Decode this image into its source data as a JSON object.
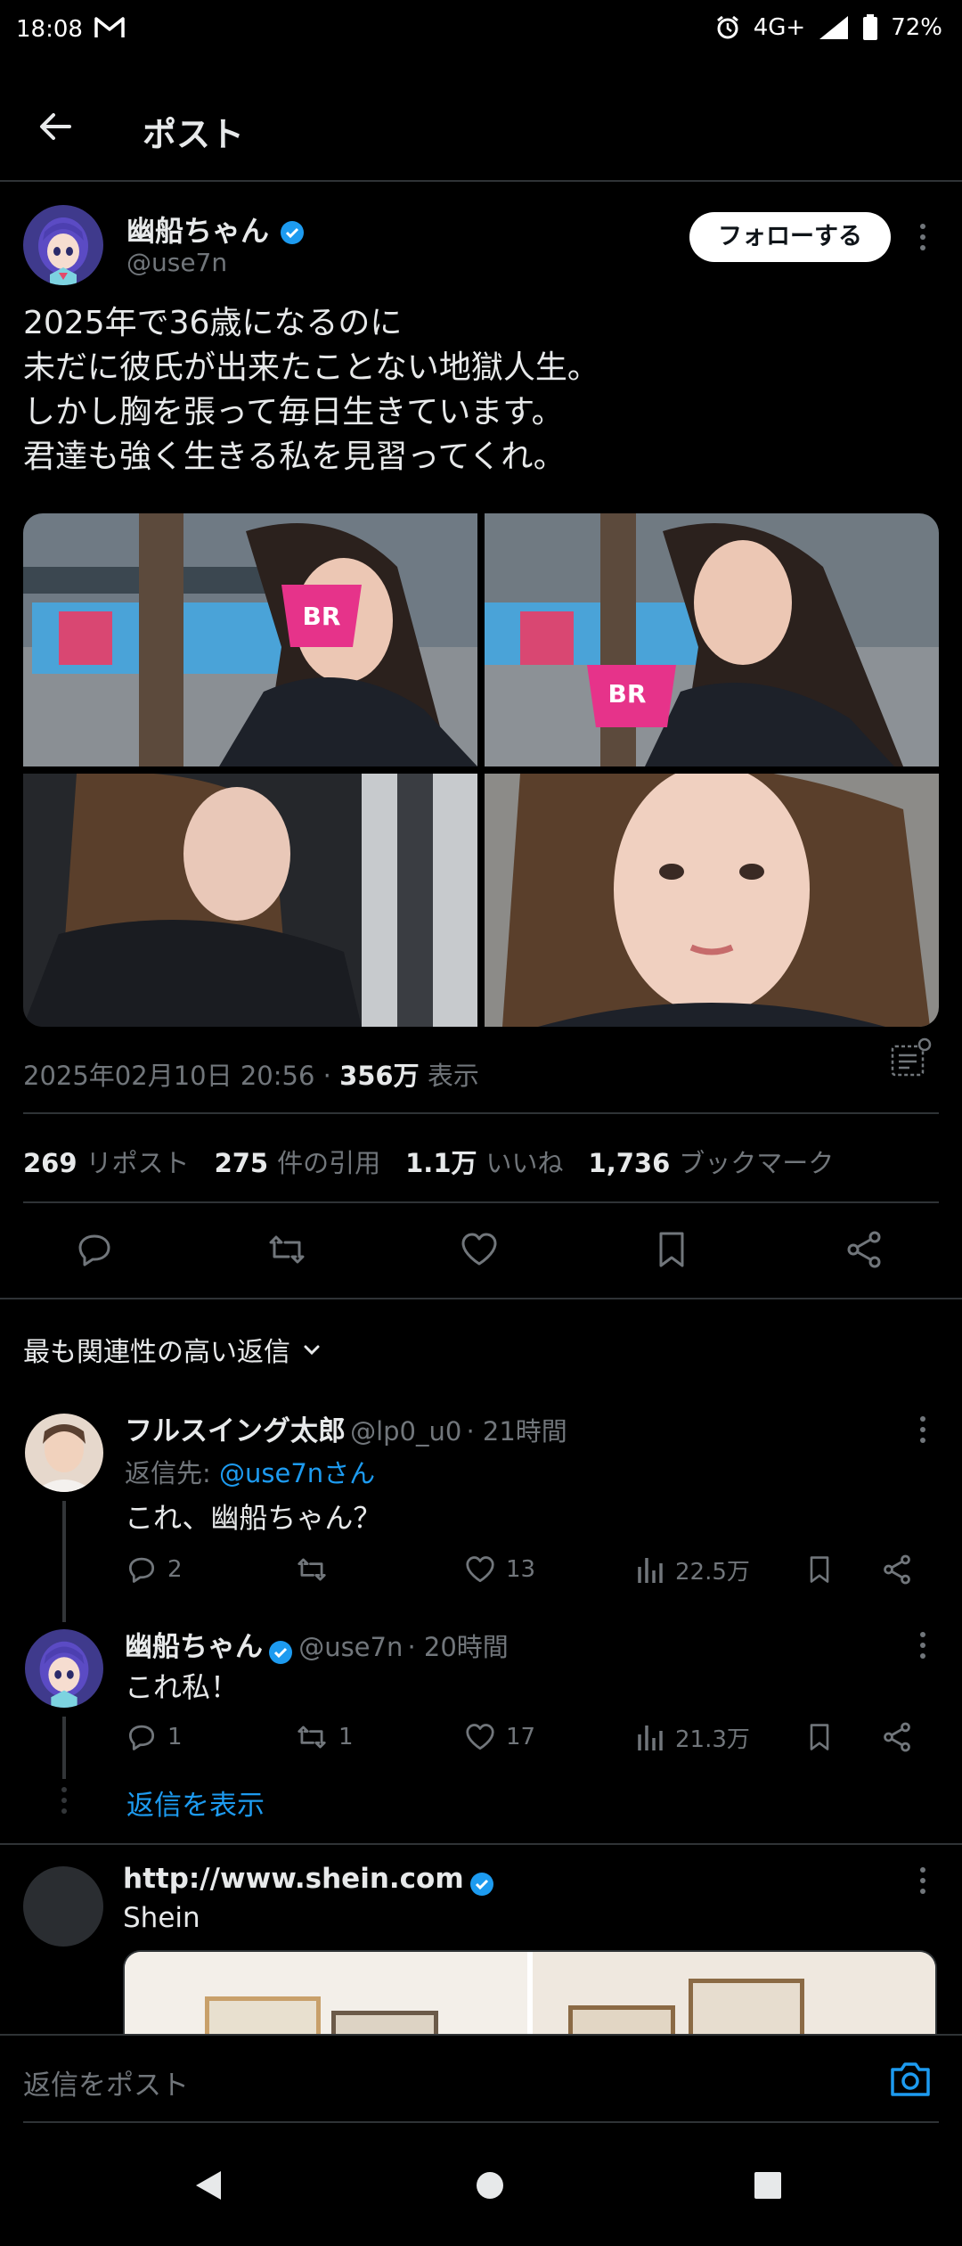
{
  "status_bar": {
    "time": "18:08",
    "network": "4G+",
    "battery": "72%"
  },
  "header": {
    "title": "ポスト"
  },
  "post": {
    "author_name": "幽船ちゃん",
    "author_handle": "@use7n",
    "follow_label": "フォローする",
    "text": "2025年で36歳になるのに\n未だに彼氏が出来たことない地獄人生。\nしかし胸を張って毎日生きています。\n君達も強く生きる私を見習ってくれ。",
    "cup_logo": "BR",
    "date": "2025年02月10日 20:56",
    "separator": "·",
    "views": "356万",
    "views_label": "表示",
    "stats": {
      "reposts": "269",
      "reposts_label": "リポスト",
      "quotes": "275",
      "quotes_label": "件の引用",
      "likes": "1.1万",
      "likes_label": "いいね",
      "bookmarks": "1,736",
      "bookmarks_label": "ブックマーク"
    }
  },
  "sort_label": "最も関連性の高い返信",
  "replies": [
    {
      "name": "フルスイング太郎",
      "handle": "@lp0_u0",
      "time": "21時間",
      "reply_to_prefix": "返信先:",
      "reply_to": "@use7nさん",
      "text": "これ、幽船ちゃん？",
      "replies": "2",
      "reposts": "",
      "likes": "13",
      "views": "22.5万"
    },
    {
      "name": "幽船ちゃん",
      "handle": "@use7n",
      "time": "20時間",
      "text": "これ私！",
      "replies": "1",
      "reposts": "1",
      "likes": "17",
      "views": "21.3万"
    }
  ],
  "show_replies_label": "返信を表示",
  "ad": {
    "name": "http://www.shein.com",
    "text": "Shein"
  },
  "reply_bar": {
    "placeholder": "返信をポスト"
  },
  "colors": {
    "background": "#000000",
    "accent": "#1d9bf0",
    "muted": "#71767b",
    "divider": "#2f3336"
  }
}
